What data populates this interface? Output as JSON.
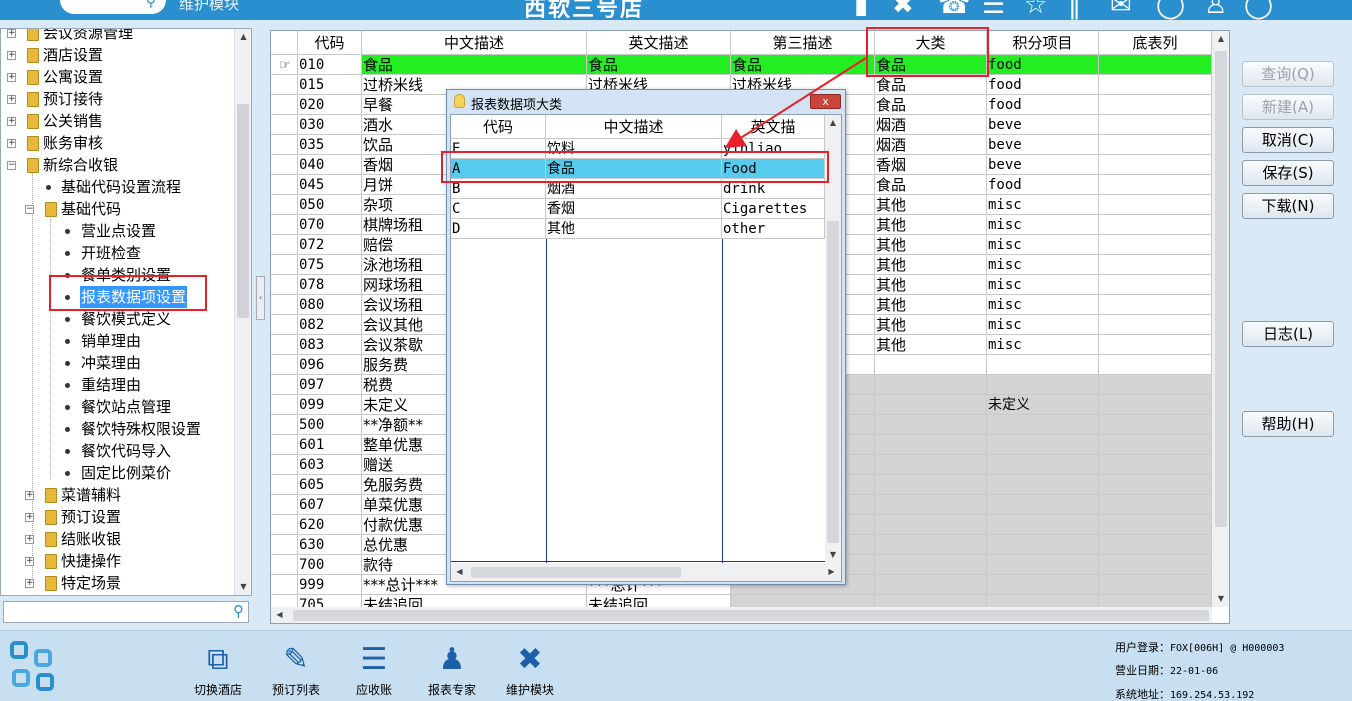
{
  "topbar": {
    "search_icon": "search-icon",
    "module_title": "维护模块",
    "hotel_name": "西软三号店",
    "icons": [
      "signal-icon",
      "tools-icon",
      "phone-icon",
      "menu-icon",
      "star-icon",
      "bars-icon",
      "mail-icon",
      "help-icon",
      "user-icon",
      "power-icon"
    ]
  },
  "tree": {
    "items": [
      {
        "label": "会议资源管理"
      },
      {
        "label": "酒店设置"
      },
      {
        "label": "公寓设置"
      },
      {
        "label": "预订接待"
      },
      {
        "label": "公关销售"
      },
      {
        "label": "账务审核"
      },
      {
        "label": "新综合收银"
      },
      {
        "label": "基础代码设置流程"
      },
      {
        "label": "基础代码"
      },
      {
        "label": "营业点设置"
      },
      {
        "label": "开班检查"
      },
      {
        "label": "餐单类别设置"
      },
      {
        "label": "报表数据项设置"
      },
      {
        "label": "餐饮模式定义"
      },
      {
        "label": "销单理由"
      },
      {
        "label": "冲菜理由"
      },
      {
        "label": "重结理由"
      },
      {
        "label": "餐饮站点管理"
      },
      {
        "label": "餐饮特殊权限设置"
      },
      {
        "label": "餐饮代码导入"
      },
      {
        "label": "固定比例菜价"
      },
      {
        "label": "菜谱辅料"
      },
      {
        "label": "预订设置"
      },
      {
        "label": "结账收银"
      },
      {
        "label": "快捷操作"
      },
      {
        "label": "特定场景"
      }
    ],
    "search_placeholder": ""
  },
  "grid": {
    "headers": [
      "代码",
      "中文描述",
      "英文描述",
      "第三描述",
      "大类",
      "积分项目",
      "底表列"
    ],
    "rows": [
      {
        "code": "010",
        "cn": "食品",
        "en": "食品",
        "third": "食品",
        "cat": "食品",
        "points": "food",
        "base": ""
      },
      {
        "code": "015",
        "cn": "过桥米线",
        "en": "过桥米线",
        "third": "过桥米线",
        "cat": "食品",
        "points": "food",
        "base": ""
      },
      {
        "code": "020",
        "cn": "早餐",
        "en": "",
        "third": "",
        "cat": "食品",
        "points": "food",
        "base": ""
      },
      {
        "code": "030",
        "cn": "酒水",
        "en": "",
        "third": "",
        "cat": "烟酒",
        "points": "beve",
        "base": ""
      },
      {
        "code": "035",
        "cn": "饮品",
        "en": "",
        "third": "",
        "cat": "烟酒",
        "points": "beve",
        "base": ""
      },
      {
        "code": "040",
        "cn": "香烟",
        "en": "",
        "third": "",
        "cat": "香烟",
        "points": "beve",
        "base": ""
      },
      {
        "code": "045",
        "cn": "月饼",
        "en": "",
        "third": "",
        "cat": "食品",
        "points": "food",
        "base": ""
      },
      {
        "code": "050",
        "cn": "杂项",
        "en": "",
        "third": "",
        "cat": "其他",
        "points": "misc",
        "base": ""
      },
      {
        "code": "070",
        "cn": "棋牌场租",
        "en": "",
        "third": "",
        "cat": "其他",
        "points": "misc",
        "base": ""
      },
      {
        "code": "072",
        "cn": "赔偿",
        "en": "",
        "third": "",
        "cat": "其他",
        "points": "misc",
        "base": ""
      },
      {
        "code": "075",
        "cn": "泳池场租",
        "en": "",
        "third": "",
        "cat": "其他",
        "points": "misc",
        "base": ""
      },
      {
        "code": "078",
        "cn": "网球场租",
        "en": "",
        "third": "",
        "cat": "其他",
        "points": "misc",
        "base": ""
      },
      {
        "code": "080",
        "cn": "会议场租",
        "en": "",
        "third": "",
        "cat": "其他",
        "points": "misc",
        "base": ""
      },
      {
        "code": "082",
        "cn": "会议其他",
        "en": "",
        "third": "",
        "cat": "其他",
        "points": "misc",
        "base": ""
      },
      {
        "code": "083",
        "cn": "会议茶歇",
        "en": "",
        "third": "",
        "cat": "其他",
        "points": "misc",
        "base": ""
      },
      {
        "code": "096",
        "cn": "服务费",
        "en": "",
        "third": "",
        "cat": "",
        "points": "",
        "base": ""
      },
      {
        "code": "097",
        "cn": "税费",
        "en": "",
        "third": "",
        "cat": "",
        "points": "",
        "base": ""
      },
      {
        "code": "099",
        "cn": "未定义",
        "en": "",
        "third": "",
        "cat": "",
        "points": "未定义",
        "base": ""
      },
      {
        "code": "500",
        "cn": "**净额**",
        "en": "",
        "third": "",
        "cat": "",
        "points": "",
        "base": ""
      },
      {
        "code": "601",
        "cn": "整单优惠",
        "en": "",
        "third": "",
        "cat": "",
        "points": "",
        "base": ""
      },
      {
        "code": "603",
        "cn": "赠送",
        "en": "",
        "third": "",
        "cat": "",
        "points": "",
        "base": ""
      },
      {
        "code": "605",
        "cn": "免服务费",
        "en": "",
        "third": "",
        "cat": "",
        "points": "",
        "base": ""
      },
      {
        "code": "607",
        "cn": "单菜优惠",
        "en": "",
        "third": "",
        "cat": "",
        "points": "",
        "base": ""
      },
      {
        "code": "620",
        "cn": "付款优惠",
        "en": "",
        "third": "",
        "cat": "",
        "points": "",
        "base": ""
      },
      {
        "code": "630",
        "cn": "总优惠",
        "en": "",
        "third": "",
        "cat": "",
        "points": "",
        "base": ""
      },
      {
        "code": "700",
        "cn": "款待",
        "en": "",
        "third": "",
        "cat": "",
        "points": "",
        "base": ""
      },
      {
        "code": "999",
        "cn": "***总计***",
        "en": "***总计***",
        "third": "",
        "cat": "",
        "points": "",
        "base": ""
      },
      {
        "code": "705",
        "cn": "未结追回",
        "en": "未结追回",
        "third": "",
        "cat": "",
        "points": "",
        "base": ""
      }
    ]
  },
  "popup": {
    "title": "报表数据项大类",
    "close_label": "x",
    "headers": [
      "代码",
      "中文描述",
      "英文描"
    ],
    "rows": [
      {
        "code": "E",
        "cn": "饮料",
        "en": "yinliao"
      },
      {
        "code": "A",
        "cn": "食品",
        "en": "Food"
      },
      {
        "code": "B",
        "cn": "烟酒",
        "en": "drink"
      },
      {
        "code": "C",
        "cn": "香烟",
        "en": "Cigarettes"
      },
      {
        "code": "D",
        "cn": "其他",
        "en": "other"
      }
    ]
  },
  "buttons": {
    "query": "查询(Q)",
    "new": "新建(A)",
    "cancel": "取消(C)",
    "save": "保存(S)",
    "download": "下载(N)",
    "log": "日志(L)",
    "help": "帮助(H)"
  },
  "bottom": {
    "items": [
      {
        "label": "切换酒店",
        "icon": "switch-hotel-icon"
      },
      {
        "label": "预订列表",
        "icon": "booking-list-icon"
      },
      {
        "label": "应收账",
        "icon": "receivable-icon"
      },
      {
        "label": "报表专家",
        "icon": "report-expert-icon"
      },
      {
        "label": "维护模块",
        "icon": "maintenance-icon"
      }
    ],
    "status": {
      "login_label": "用户登录：",
      "login_value": "FOX[006H] @ H000003",
      "date_label": "营业日期：",
      "date_value": "22-01-06",
      "addr_label": "系统地址：",
      "addr_value": "169.254.53.192"
    }
  },
  "colors": {
    "accent": "#2a8fce",
    "selected_row": "#22ee22",
    "popup_selected_row": "#55ccee",
    "highlight_box": "#e8202a",
    "disabled_row": "#d4d4d4"
  }
}
